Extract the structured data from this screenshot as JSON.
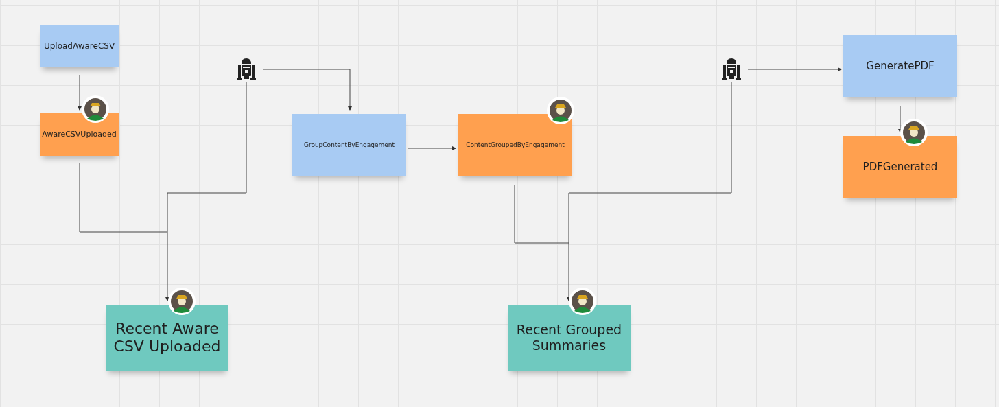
{
  "notes": [
    {
      "text": "UploadAwareCSV",
      "color": "#a8cbf3",
      "avatar": false
    },
    {
      "text": "AwareCSVUploaded",
      "color": "#ffa04f",
      "avatar": true
    },
    {
      "text": "GroupContentByEngagement",
      "color": "#a8cbf3",
      "avatar": false
    },
    {
      "text": "ContentGroupedByEngagement",
      "color": "#ffa04f",
      "avatar": true
    },
    {
      "text": "GeneratePDF",
      "color": "#a8cbf3",
      "avatar": false
    },
    {
      "text": "PDFGenerated",
      "color": "#ffa04f",
      "avatar": true
    },
    {
      "text": "Recent Aware CSV Uploaded",
      "color": "#6fc9bf",
      "avatar": true
    },
    {
      "text": "Recent Grouped Summaries",
      "color": "#6fc9bf",
      "avatar": true
    }
  ],
  "robots": [
    {
      "kind": "robot"
    },
    {
      "kind": "robot"
    }
  ]
}
